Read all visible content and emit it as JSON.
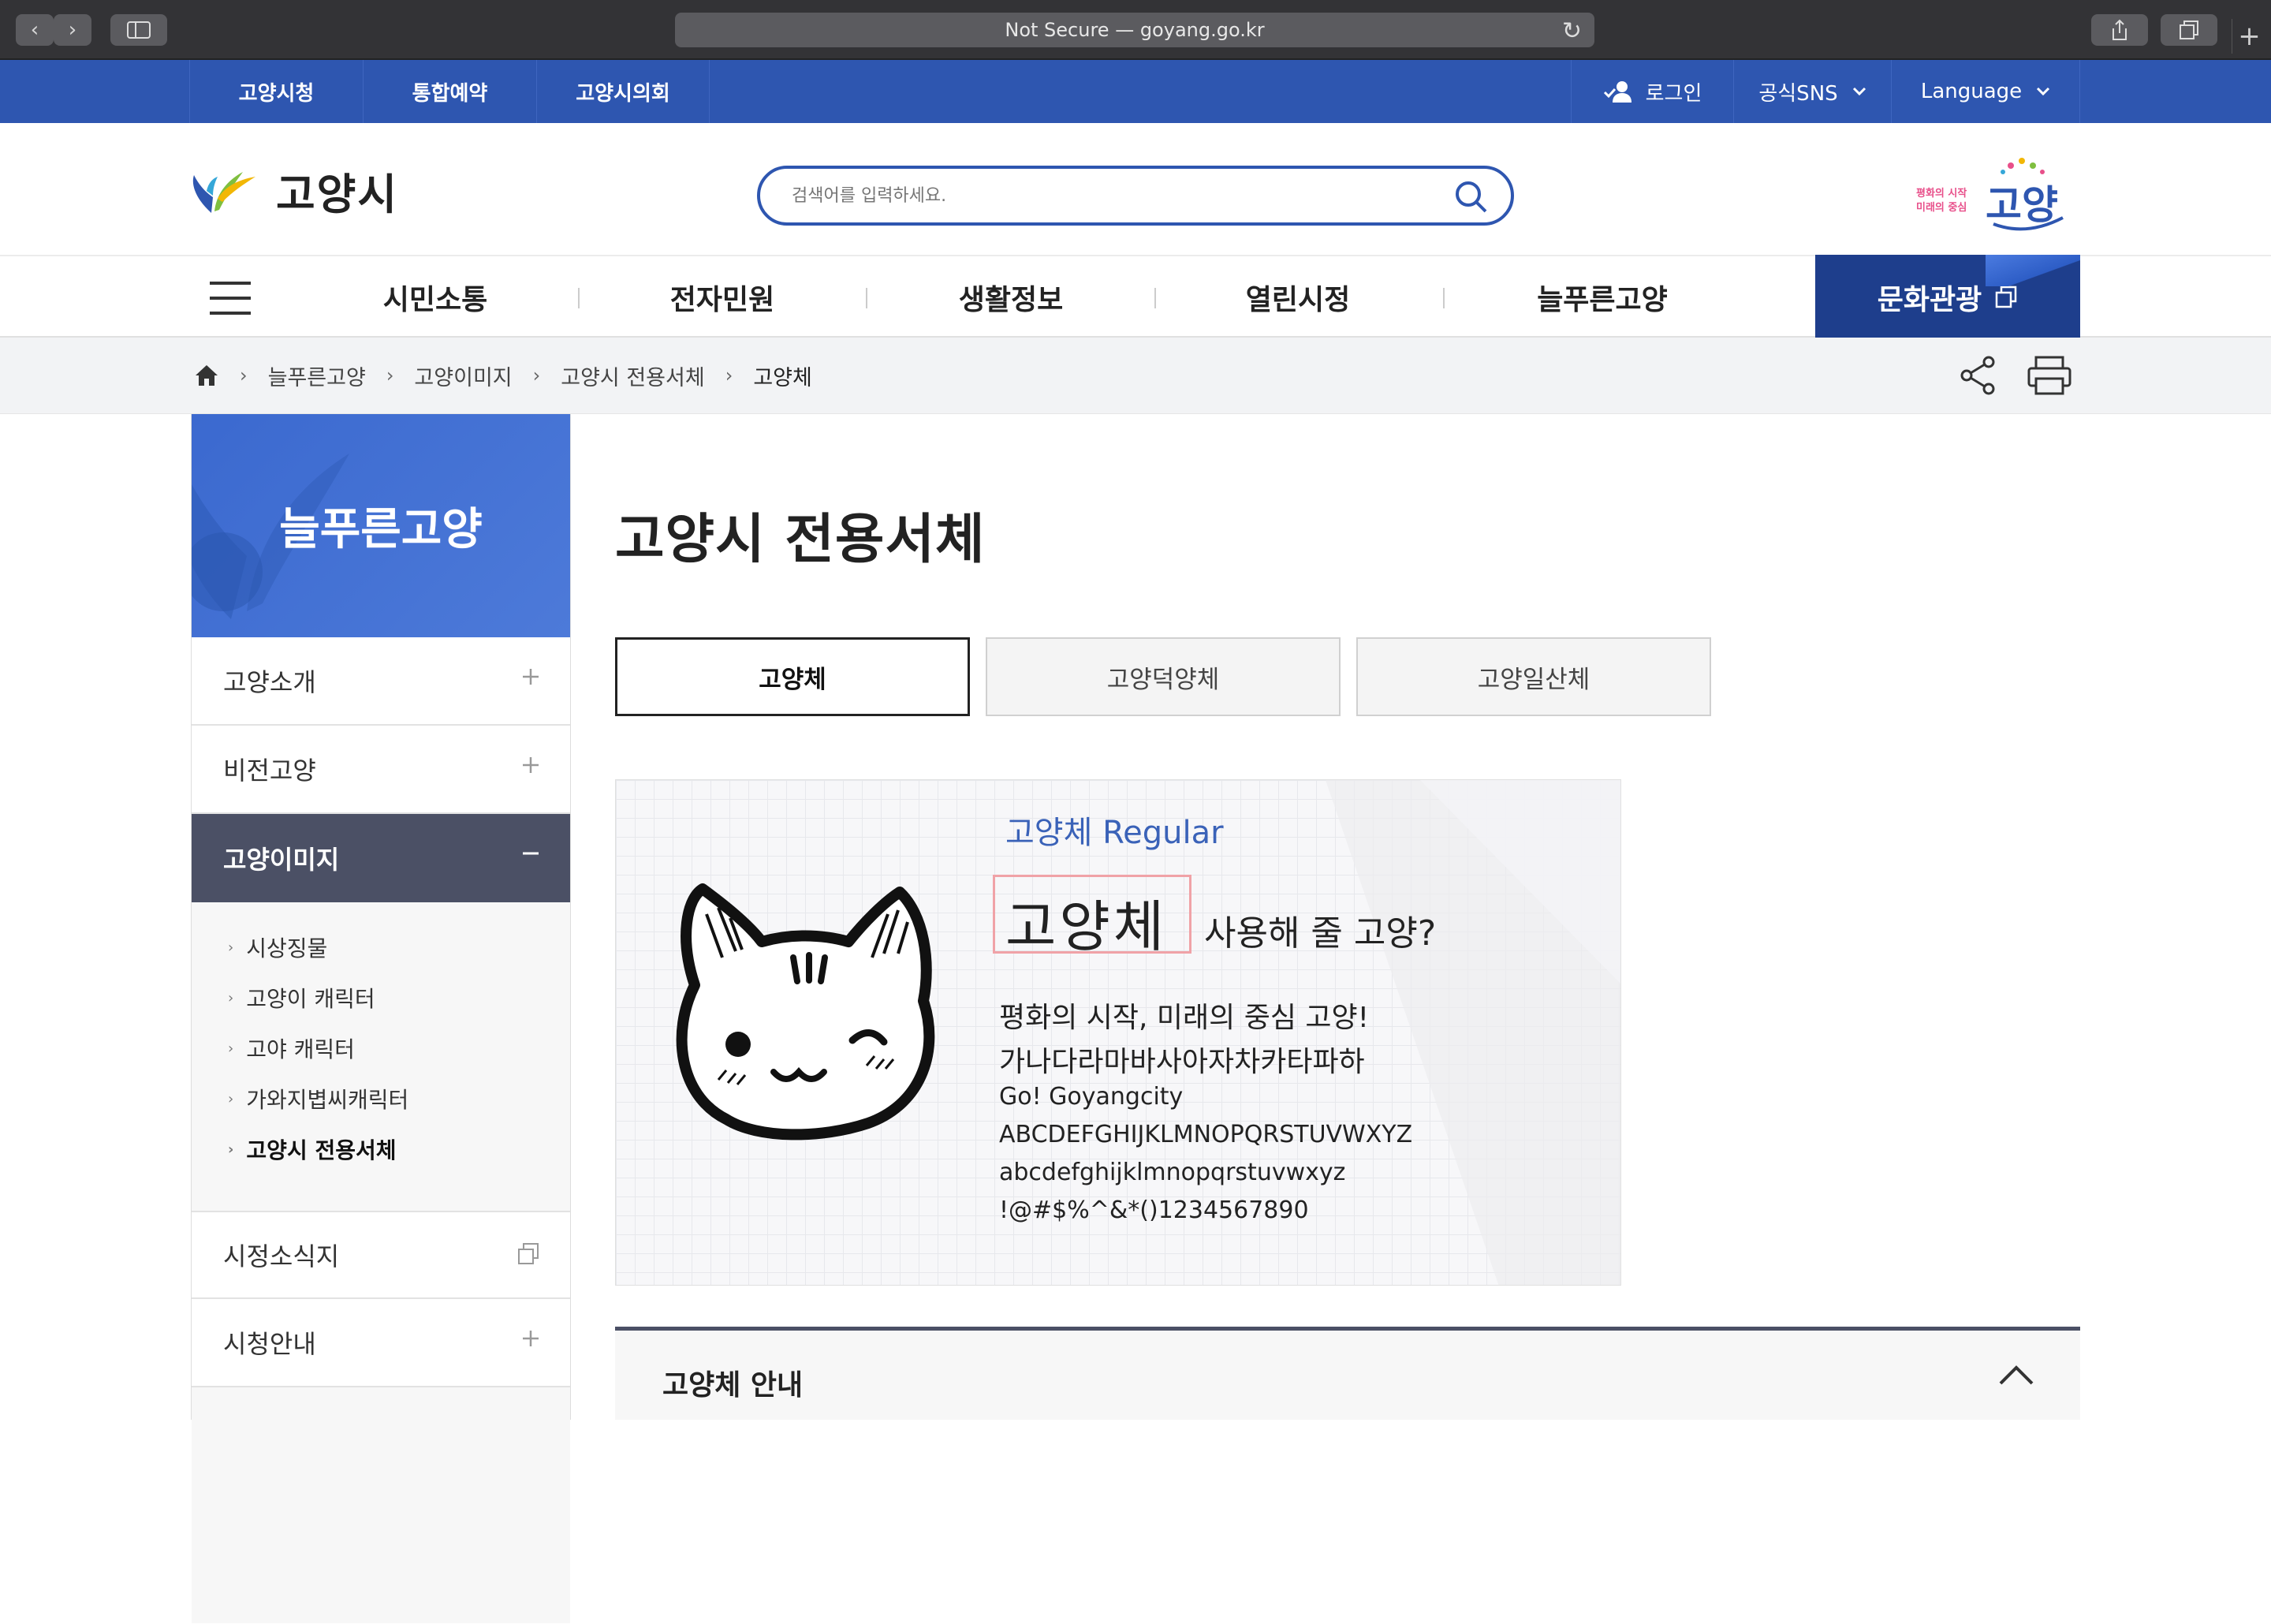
{
  "browser": {
    "url_text": "Not Secure — goyang.go.kr"
  },
  "topbar": {
    "links": [
      "고양시청",
      "통합예약",
      "고양시의회"
    ],
    "login": "로그인",
    "sns": "공식SNS",
    "language": "Language"
  },
  "header": {
    "logo_text": "고양시",
    "search_placeholder": "검색어를 입력하세요.",
    "slogan_small_1": "평화의 시작",
    "slogan_small_2": "미래의 중심",
    "slogan_big": "고양"
  },
  "gnb": {
    "items": [
      "시민소통",
      "전자민원",
      "생활정보",
      "열린시정",
      "늘푸른고양"
    ],
    "culture": "문화관광"
  },
  "breadcrumb": [
    "늘푸른고양",
    "고양이미지",
    "고양시 전용서체",
    "고양체"
  ],
  "side": {
    "title": "늘푸른고양",
    "items": [
      "고양소개",
      "비전고양",
      "고양이미지",
      "시정소식지",
      "시청안내"
    ],
    "sub_items": [
      "시상징물",
      "고양이 캐릭터",
      "고야 캐릭터",
      "가와지볍씨캐릭터",
      "고양시 전용서체"
    ]
  },
  "main": {
    "title": "고양시 전용서체",
    "tabs": [
      "고양체",
      "고양덕양체",
      "고양일산체"
    ],
    "sample": {
      "font_name": "고양체 Regular",
      "big_word": "고양체",
      "big_sub": "사용해 줄 고양?",
      "lines": [
        "평화의 시작, 미래의 중심 고양!",
        "가나다라마바사아자차카타파하",
        "Go! Goyangcity",
        "ABCDEFGHIJKLMNOPQRSTUVWXYZ",
        "abcdefghijklmnopqrstuvwxyz",
        "!@#$%^&*()1234567890"
      ]
    },
    "accordion_title": "고양체 안내"
  },
  "colors": {
    "topbar_blue": "#2e56b0",
    "culture_navy": "#1e3e8c",
    "side_active": "#4b5065"
  }
}
